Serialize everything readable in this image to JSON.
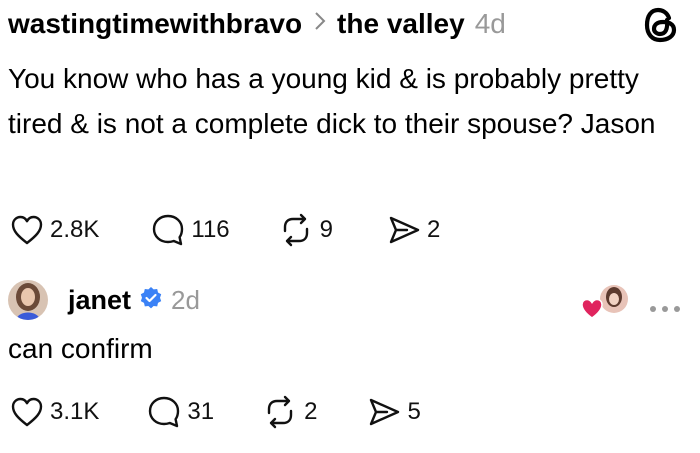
{
  "post": {
    "author": "wastingtimewithbravo",
    "community": "the valley",
    "age": "4d",
    "text": "You know who has a young kid & is probably pretty tired & is not a complete dick to their spouse? Jason",
    "likes": "2.8K",
    "replies": "116",
    "reposts": "9",
    "shares": "2"
  },
  "reply": {
    "author": "janet",
    "age": "2d",
    "text": "can confirm",
    "likes": "3.1K",
    "replies": "31",
    "reposts": "2",
    "shares": "5"
  },
  "icons": {
    "app": "threads-logo-icon",
    "like": "heart-icon",
    "reply": "comment-bubble-icon",
    "repost": "repost-icon",
    "share": "send-icon",
    "verified": "verified-badge-icon",
    "more": "more-dots-icon"
  },
  "colors": {
    "verified": "#3b82f6",
    "liked_heart": "#e0245e",
    "muted_text": "#999999"
  }
}
